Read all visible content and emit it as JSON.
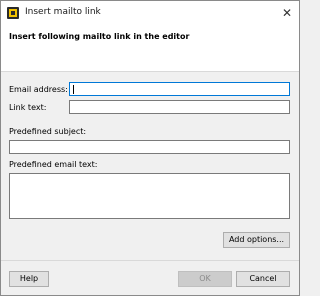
{
  "window": {
    "title": "Insert mailto link",
    "close_glyph": "✕",
    "icon": "app-icon"
  },
  "header": {
    "text": "Insert following mailto link in the editor"
  },
  "form": {
    "email_label": "Email address:",
    "email_value": "",
    "link_text_label": "Link text:",
    "link_text_value": "",
    "subject_label": "Predefined subject:",
    "subject_value": "",
    "body_label": "Predefined email text:",
    "body_value": ""
  },
  "buttons": {
    "add_options": "Add options...",
    "help": "Help",
    "ok": "OK",
    "cancel": "Cancel"
  },
  "colors": {
    "focus_border": "#0078d7",
    "disabled_text": "#8c8c8c"
  }
}
